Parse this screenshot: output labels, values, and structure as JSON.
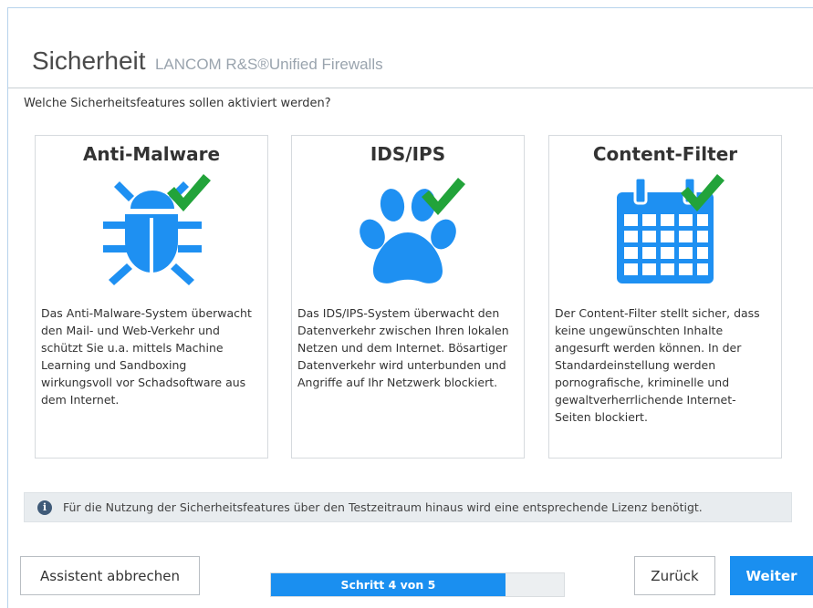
{
  "header": {
    "title": "Sicherheit",
    "subtitle": "LANCOM R&S®Unified Firewalls"
  },
  "question": "Welche Sicherheitsfeatures sollen aktiviert werden?",
  "cards": [
    {
      "title": "Anti-Malware",
      "icon": "bug-icon",
      "checked": true,
      "description": "Das Anti-Malware-System überwacht den Mail- und Web-Verkehr und schützt Sie u.a. mittels Machine Learning und Sandboxing wirkungsvoll vor Schadsoftware aus dem Internet."
    },
    {
      "title": "IDS/IPS",
      "icon": "paw-icon",
      "checked": true,
      "description": "Das IDS/IPS-System überwacht den Datenverkehr zwischen Ihren lokalen Netzen und dem Internet. Bösartiger Datenverkehr wird unterbunden und Angriffe auf Ihr Netzwerk blockiert."
    },
    {
      "title": "Content-Filter",
      "icon": "calendar-icon",
      "checked": true,
      "description": "Der Content-Filter stellt sicher, dass keine ungewünschten Inhalte angesurft werden können. In der Standardeinstellung werden pornografische, kriminelle und gewaltverherrlichende Internet-Seiten blockiert."
    }
  ],
  "info": {
    "icon": "info-icon",
    "text": "Für die Nutzung der Sicherheitsfeatures über den Testzeitraum hinaus wird eine entsprechende Lizenz benötigt."
  },
  "footer": {
    "cancel_label": "Assistent abbrechen",
    "progress_label": "Schritt 4 von 5",
    "progress_fraction": 0.8,
    "back_label": "Zurück",
    "next_label": "Weiter"
  },
  "colors": {
    "accent": "#1a8ff0",
    "check": "#22a33a",
    "icon_blue": "#1e90f2"
  }
}
